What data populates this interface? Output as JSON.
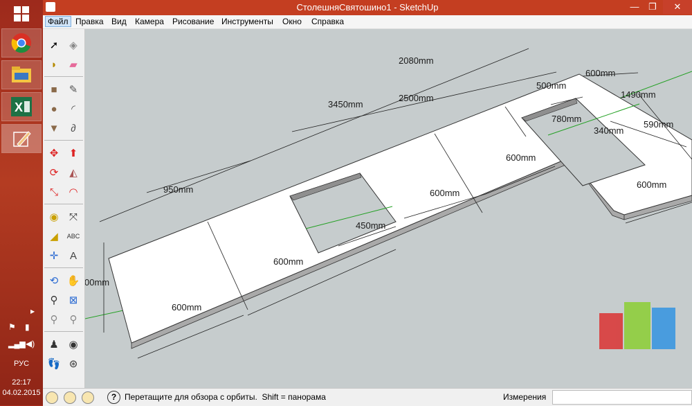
{
  "window": {
    "title": "СтолешняСвятошино1 - SketchUp",
    "controls": {
      "minimize": "—",
      "maximize": "❐",
      "close": "✕"
    }
  },
  "menu": {
    "items": [
      "Файл",
      "Правка",
      "Вид",
      "Камера",
      "Рисование",
      "Инструменты",
      "Окно",
      "Справка"
    ],
    "open_index": 0
  },
  "toolbar": {
    "tools": [
      "select",
      "make-component",
      "paint-bucket",
      "eraser",
      "rectangle",
      "line",
      "circle",
      "arc",
      "polygon",
      "freehand",
      "move",
      "push-pull",
      "rotate",
      "follow-me",
      "scale",
      "offset",
      "tape-measure",
      "dimension",
      "protractor",
      "text",
      "axes",
      "3d-text",
      "orbit",
      "pan",
      "zoom",
      "zoom-window",
      "previous-view",
      "next-view",
      "position-camera",
      "look-around",
      "walk",
      "section-plane"
    ]
  },
  "dimensions": {
    "d2080": "2080mm",
    "d3450": "3450mm",
    "d2500": "2500mm",
    "d600_top_right": "600mm",
    "d500": "500mm",
    "d1490": "1490mm",
    "d780": "780mm",
    "d590": "590mm",
    "d340": "340mm",
    "d950": "950mm",
    "d600_mid_right": "600mm",
    "d600_mid": "600mm",
    "d600_bottom_right": "600mm",
    "d450": "450mm",
    "d600_front": "600mm",
    "d600_bottom_left": "600mm",
    "d_left_partial": "00mm"
  },
  "statusbar": {
    "hint": "Перетащите для обзора с орбиты.  Shift = панорама",
    "measure_label": "Измерения",
    "measure_value": ""
  },
  "taskbar": {
    "lang": "РУС",
    "time": "22:17",
    "date": "04.02.2015"
  },
  "colors": {
    "titlebar": "#c43e21",
    "viewport": "#c6cccd",
    "taskbar": "#ab2a1a",
    "axis_green": "#22a022"
  }
}
